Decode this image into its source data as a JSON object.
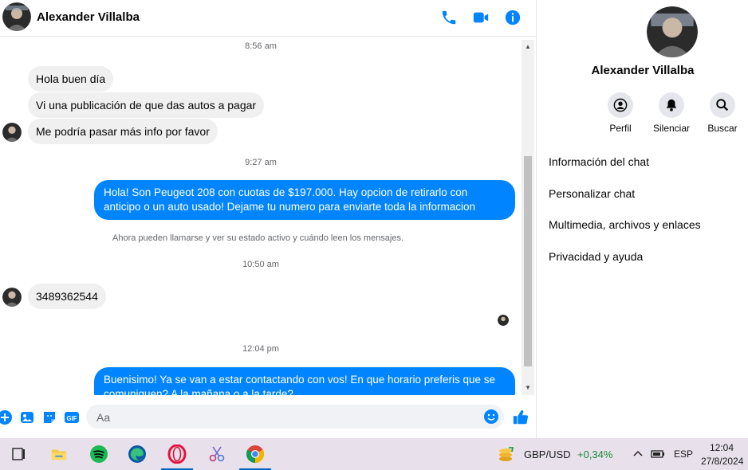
{
  "header": {
    "name": "Alexander Villalba",
    "icons": [
      "phone-icon",
      "video-icon",
      "info-icon"
    ]
  },
  "messages": {
    "ts1": "8:56 am",
    "in1": "Hola buen día",
    "in2": "Vi una publicación de que das autos a pagar",
    "in3": "Me podría pasar más info por favor",
    "ts2": "9:27 am",
    "out1": "Hola! Son Peugeot 208 con cuotas de $197.000. Hay opcion de retirarlo con anticipo o un auto usado! Dejame tu numero para enviarte toda la informacion",
    "notice": "Ahora pueden llamarse y ver su estado activo y cuándo leen los mensajes.",
    "ts3": "10:50 am",
    "in4": "3489362544",
    "ts4": "12:04 pm",
    "out2": "Buenisimo! Ya se van a estar contactando con vos! En que horario preferis que se comuniquen? A la mañana o a la tarde?"
  },
  "composer": {
    "placeholder": "Aa"
  },
  "info": {
    "name": "Alexander Villalba",
    "actions": {
      "perfil": "Perfil",
      "silenciar": "Silenciar",
      "buscar": "Buscar"
    },
    "menu": {
      "chat_info": "Información del chat",
      "customize": "Personalizar chat",
      "media": "Multimedia, archivos y enlaces",
      "privacy": "Privacidad y ayuda"
    }
  },
  "taskbar": {
    "ticker": "GBP/USD",
    "change": "+0,34%",
    "lang": "ESP",
    "time": "12:04",
    "date": "27/8/2024"
  },
  "colors": {
    "accent": "#0084ff",
    "bubble_in": "#f0f0f0",
    "taskbar": "#e8e1ec"
  }
}
